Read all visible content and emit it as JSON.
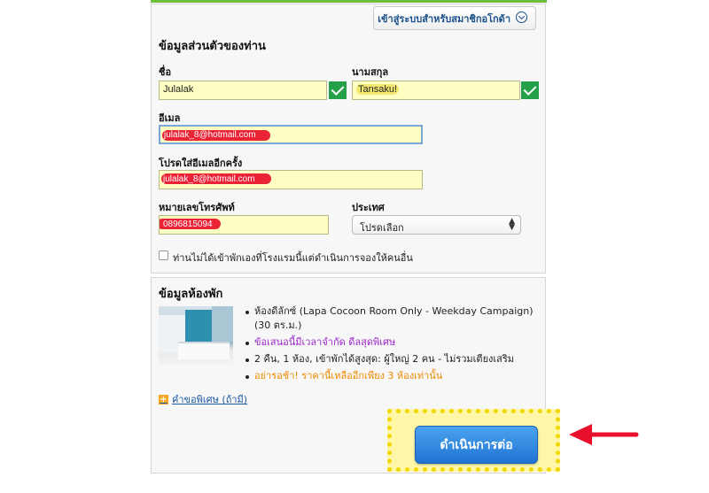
{
  "header": {
    "login_label": "เข้าสู่ระบบสำหรับสมาชิกอโกด้า"
  },
  "personal": {
    "title": "ข้อมูลส่วนตัวของท่าน",
    "first_name_label": "ชื่อ",
    "first_name_value": "Julalak",
    "last_name_label": "นามสกุล",
    "last_name_value": "Tansaku!",
    "email_label": "อีเมล",
    "email_value": "julalak_8@hotmail.com",
    "email_confirm_label": "โปรดใส่อีเมลอีกครั้ง",
    "email_confirm_value": "julalak_8@hotmail.com",
    "phone_label": "หมายเลขโทรศัพท์",
    "phone_value": "0896815094",
    "country_label": "ประเทศ",
    "country_value": "โปรดเลือก",
    "booking_for_other_label": "ท่านไม่ได้เข้าพักเองที่โรงแรมนี้แต่ดำเนินการจองให้คนอื่น"
  },
  "room": {
    "title": "ข้อมูลห้องพัก",
    "details": [
      "ห้องดีลักซ์ (Lapa Cocoon Room Only - Weekday Campaign) (30 ตร.ม.)",
      "ข้อเสนอนี้มีเวลาจำกัด ดีลสุดพิเศษ",
      "2 คืน, 1 ห้อง, เข้าพักได้สูงสุด: ผู้ใหญ่ 2 คน - ไม่รวมเตียงเสริม",
      "อย่ารอช้า! ราคานี้เหลืออีกเพียง 3 ห้องเท่านั้น"
    ],
    "special_request_label": "คำขอพิเศษ (ถ้ามี)"
  },
  "actions": {
    "continue_label": "ดำเนินการต่อ"
  },
  "colors": {
    "accent_blue": "#1f74d1",
    "valid_green": "#24a148",
    "annotation_red": "#e8102a",
    "annotation_yellow": "#f0d800"
  }
}
